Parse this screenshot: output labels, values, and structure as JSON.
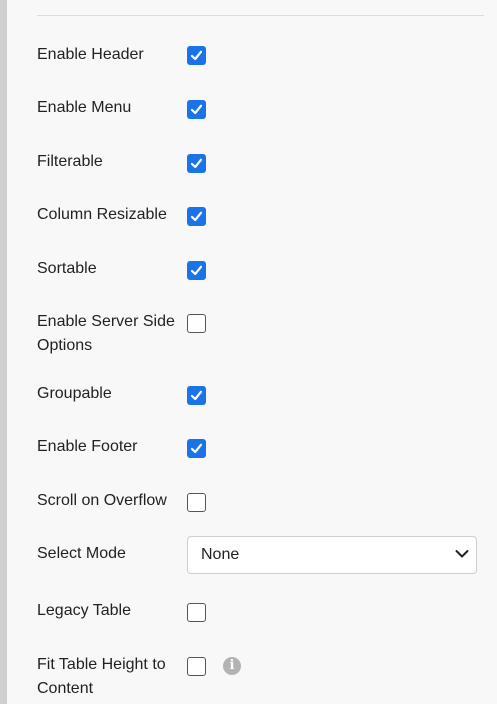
{
  "options": [
    {
      "label": "Enable Header",
      "checked": true
    },
    {
      "label": "Enable Menu",
      "checked": true
    },
    {
      "label": "Filterable",
      "checked": true
    },
    {
      "label": "Column Resizable",
      "checked": true
    },
    {
      "label": "Sortable",
      "checked": true
    },
    {
      "label": "Enable Server Side Options",
      "checked": false
    },
    {
      "label": "Groupable",
      "checked": true
    },
    {
      "label": "Enable Footer",
      "checked": true
    },
    {
      "label": "Scroll on Overflow",
      "checked": false
    }
  ],
  "select_mode": {
    "label": "Select Mode",
    "value": "None"
  },
  "legacy_table": {
    "label": "Legacy Table",
    "checked": false
  },
  "fit_height": {
    "label": "Fit Table Height to Content",
    "checked": false,
    "info_icon": "info-circle-icon"
  },
  "colors": {
    "accent": "#1a73e8",
    "background": "#f8f8f8"
  }
}
